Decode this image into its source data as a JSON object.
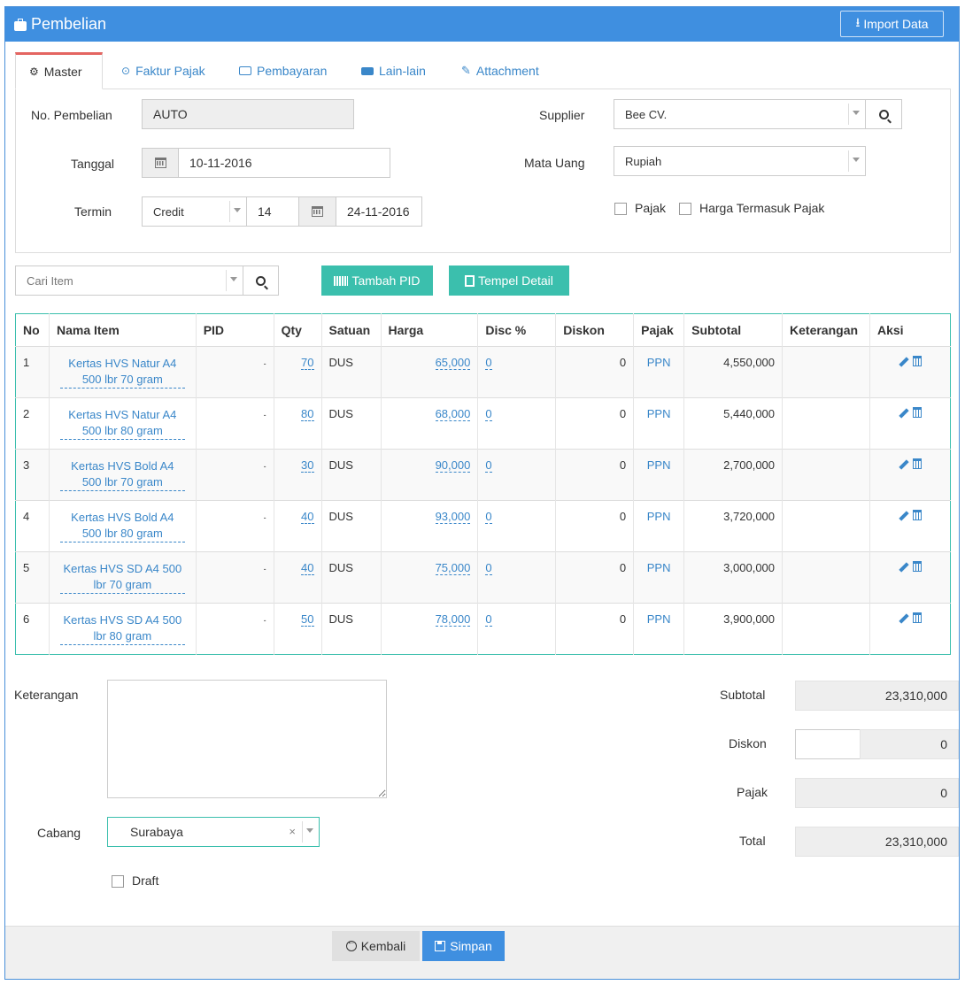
{
  "header": {
    "title": "Pembelian",
    "import_label": "Import Data"
  },
  "tabs": [
    {
      "label": "Master",
      "icon": "gears-icon"
    },
    {
      "label": "Faktur Pajak",
      "icon": "check-circle-icon"
    },
    {
      "label": "Pembayaran",
      "icon": "money-icon"
    },
    {
      "label": "Lain-lain",
      "icon": "truck-icon"
    },
    {
      "label": "Attachment",
      "icon": "paperclip-icon"
    }
  ],
  "form": {
    "no_pembelian_label": "No. Pembelian",
    "no_pembelian_value": "AUTO",
    "tanggal_label": "Tanggal",
    "tanggal_value": "10-11-2016",
    "termin_label": "Termin",
    "termin_type": "Credit",
    "termin_days": "14",
    "termin_due": "24-11-2016",
    "supplier_label": "Supplier",
    "supplier_value": "Bee CV.",
    "mata_uang_label": "Mata Uang",
    "mata_uang_value": "Rupiah",
    "pajak_label": "Pajak",
    "harga_termasuk_pajak_label": "Harga Termasuk Pajak"
  },
  "toolbar": {
    "search_placeholder": "Cari Item",
    "tambah_pid_label": "Tambah PID",
    "tempel_detail_label": "Tempel Detail"
  },
  "table": {
    "headers": [
      "No",
      "Nama Item",
      "PID",
      "Qty",
      "Satuan",
      "Harga",
      "Disc %",
      "Diskon",
      "Pajak",
      "Subtotal",
      "Keterangan",
      "Aksi"
    ],
    "rows": [
      {
        "no": "1",
        "name": "Kertas HVS Natur A4 500 lbr 70 gram",
        "pid": "-",
        "qty": "70",
        "satuan": "DUS",
        "harga": "65,000",
        "disc": "0",
        "diskon": "0",
        "pajak": "PPN",
        "subtotal": "4,550,000",
        "keterangan": ""
      },
      {
        "no": "2",
        "name": "Kertas HVS Natur A4 500 lbr 80 gram",
        "pid": "-",
        "qty": "80",
        "satuan": "DUS",
        "harga": "68,000",
        "disc": "0",
        "diskon": "0",
        "pajak": "PPN",
        "subtotal": "5,440,000",
        "keterangan": ""
      },
      {
        "no": "3",
        "name": "Kertas HVS Bold A4 500 lbr 70 gram",
        "pid": "-",
        "qty": "30",
        "satuan": "DUS",
        "harga": "90,000",
        "disc": "0",
        "diskon": "0",
        "pajak": "PPN",
        "subtotal": "2,700,000",
        "keterangan": ""
      },
      {
        "no": "4",
        "name": "Kertas HVS Bold A4 500 lbr 80 gram",
        "pid": "-",
        "qty": "40",
        "satuan": "DUS",
        "harga": "93,000",
        "disc": "0",
        "diskon": "0",
        "pajak": "PPN",
        "subtotal": "3,720,000",
        "keterangan": ""
      },
      {
        "no": "5",
        "name": "Kertas HVS SD A4 500 lbr 70 gram",
        "pid": "-",
        "qty": "40",
        "satuan": "DUS",
        "harga": "75,000",
        "disc": "0",
        "diskon": "0",
        "pajak": "PPN",
        "subtotal": "3,000,000",
        "keterangan": ""
      },
      {
        "no": "6",
        "name": "Kertas HVS SD A4 500 lbr 80 gram",
        "pid": "-",
        "qty": "50",
        "satuan": "DUS",
        "harga": "78,000",
        "disc": "0",
        "diskon": "0",
        "pajak": "PPN",
        "subtotal": "3,900,000",
        "keterangan": ""
      }
    ]
  },
  "bottom": {
    "keterangan_label": "Keterangan",
    "keterangan_value": "",
    "cabang_label": "Cabang",
    "cabang_value": "Surabaya",
    "draft_label": "Draft",
    "subtotal_label": "Subtotal",
    "subtotal_value": "23,310,000",
    "diskon_label": "Diskon",
    "diskon_input": "",
    "diskon_value": "0",
    "pajak_label": "Pajak",
    "pajak_value": "0",
    "total_label": "Total",
    "total_value": "23,310,000"
  },
  "footer": {
    "kembali_label": "Kembali",
    "simpan_label": "Simpan"
  },
  "colors": {
    "primary": "#3f8fe0",
    "teal": "#3bbfad",
    "link": "#3a87c9",
    "tab_accent": "#e46561"
  }
}
